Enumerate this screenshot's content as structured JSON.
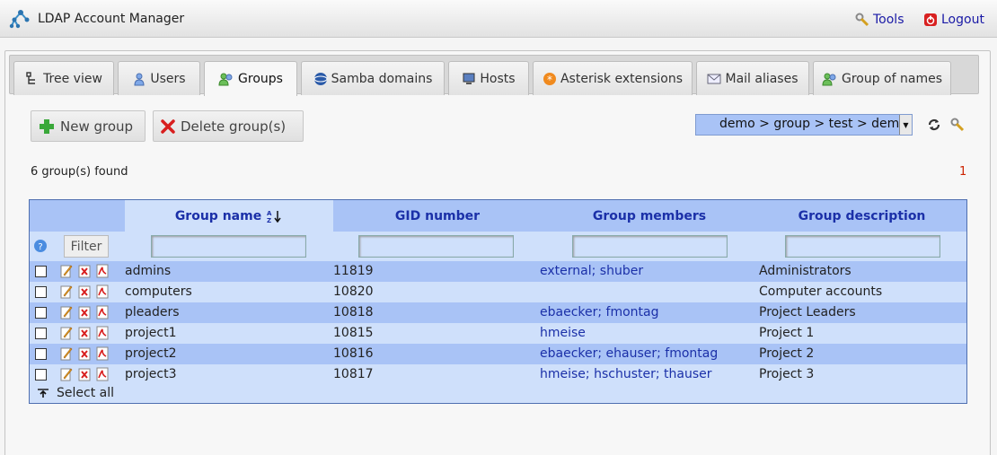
{
  "app": {
    "title": "LDAP Account Manager"
  },
  "top_links": {
    "tools": "Tools",
    "logout": "Logout"
  },
  "tabs": [
    {
      "label": "Tree view",
      "icon": "tree-icon"
    },
    {
      "label": "Users",
      "icon": "user-icon"
    },
    {
      "label": "Groups",
      "icon": "group-icon",
      "active": true
    },
    {
      "label": "Samba domains",
      "icon": "samba-icon"
    },
    {
      "label": "Hosts",
      "icon": "host-icon"
    },
    {
      "label": "Asterisk extensions",
      "icon": "asterisk-icon"
    },
    {
      "label": "Mail aliases",
      "icon": "mail-icon"
    },
    {
      "label": "Group of names",
      "icon": "group-icon"
    }
  ],
  "toolbar": {
    "new_label": "New group",
    "delete_label": "Delete group(s)"
  },
  "suffix": {
    "value": "demo > group > test > demo"
  },
  "list": {
    "count_text": "6 group(s) found",
    "page": "1",
    "filter_label": "Filter",
    "select_all_label": "Select all",
    "columns": [
      "Group name",
      "GID number",
      "Group members",
      "Group description"
    ],
    "sorted_column": "Group name",
    "rows": [
      {
        "name": "admins",
        "gid": "11819",
        "members": "external; shuber",
        "description": "Administrators"
      },
      {
        "name": "computers",
        "gid": "10820",
        "members": "",
        "description": "Computer accounts"
      },
      {
        "name": "pleaders",
        "gid": "10818",
        "members": "ebaecker; fmontag",
        "description": "Project Leaders"
      },
      {
        "name": "project1",
        "gid": "10815",
        "members": "hmeise",
        "description": "Project 1"
      },
      {
        "name": "project2",
        "gid": "10816",
        "members": "ebaecker; ehauser; fmontag",
        "description": "Project 2"
      },
      {
        "name": "project3",
        "gid": "10817",
        "members": "hmeise; hschuster; thauser",
        "description": "Project 3"
      }
    ]
  }
}
